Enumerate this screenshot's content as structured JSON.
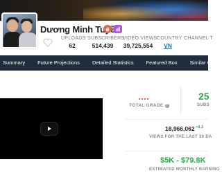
{
  "channel": {
    "name": "Dương Minh Tuyền"
  },
  "stats": {
    "uploads": {
      "label": "UPLOADS",
      "value": "62"
    },
    "subscribers": {
      "label": "SUBSCRIBERS",
      "value": "514,439"
    },
    "video_views": {
      "label": "VIDEO VIEWS",
      "value": "39,725,554"
    },
    "country": {
      "label": "COUNTRY",
      "value": "VN"
    },
    "channel_type": {
      "label": "CHANNEL T"
    }
  },
  "nav": {
    "items": [
      "Summary",
      "Future Projections",
      "Detailed Statistics",
      "Featured Box",
      "Similar Channels"
    ]
  },
  "summary": {
    "total_grade_label": "TOTAL GRADE",
    "right_rank_value": "25",
    "right_rank_label": "SUBS",
    "views_30_value": "18,966,062",
    "views_30_delta": "+8.1",
    "views_30_label": "VIEWS FOR THE LAST 30 DA",
    "earnings_value": "$5K - $79.8K",
    "earnings_label": "ESTIMATED MONTHLY EARNING"
  },
  "colors": {
    "nav_bg": "#1f2d3d",
    "accent_green": "#2eaa4a",
    "badge_fire": "#e4624a",
    "badge_chart": "#a85ad8",
    "link_blue": "#2b6cb0"
  },
  "icons": {
    "badge_1": "fire-icon",
    "badge_2": "bar-chart-icon",
    "favorite": "heart-icon",
    "video": "play-icon",
    "grade_help": "info-icon"
  }
}
